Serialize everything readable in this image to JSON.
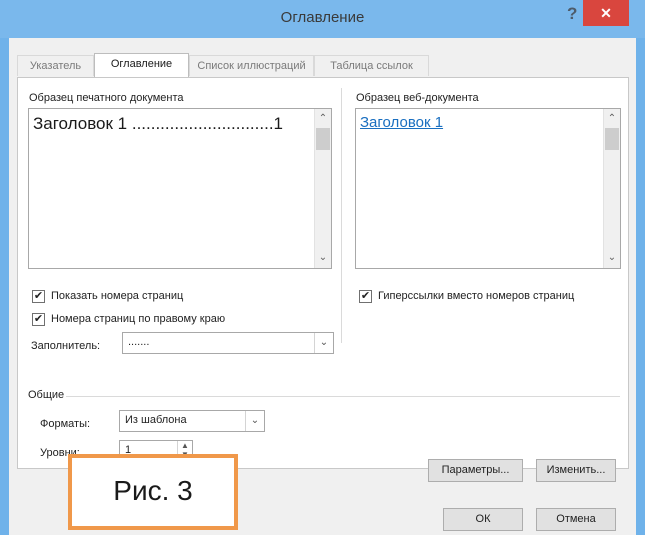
{
  "window": {
    "title": "Оглавление",
    "help": "?",
    "close": "✕"
  },
  "tabs": [
    "Указатель",
    "Оглавление",
    "Список иллюстраций",
    "Таблица ссылок"
  ],
  "print_preview": {
    "label": "Образец печатного документа",
    "heading": "Заголовок 1",
    "leader": "..............................",
    "page": "1"
  },
  "web_preview": {
    "label": "Образец веб-документа",
    "link": "Заголовок 1"
  },
  "scroll": {
    "up": "⌃",
    "down": "⌄"
  },
  "options": {
    "show_page_numbers": "Показать номера страниц",
    "right_align": "Номера страниц по правому краю",
    "hyperlinks": "Гиперссылки вместо номеров страниц",
    "check": "✔",
    "filler_label": "Заполнитель:",
    "filler_value": "......."
  },
  "general": {
    "label": "Общие",
    "formats_label": "Форматы:",
    "formats_value": "Из шаблона",
    "levels_label": "Уровни:",
    "levels_value": "1"
  },
  "buttons": {
    "parameters": "Параметры...",
    "modify": "Изменить...",
    "ok": "ОК",
    "cancel": "Отмена"
  },
  "callout": "Рис. 3",
  "colors": {
    "titlebar": "#7ab8ec",
    "close": "#d9463e",
    "callout_border": "#f0984a",
    "link": "#1a6fc0"
  }
}
